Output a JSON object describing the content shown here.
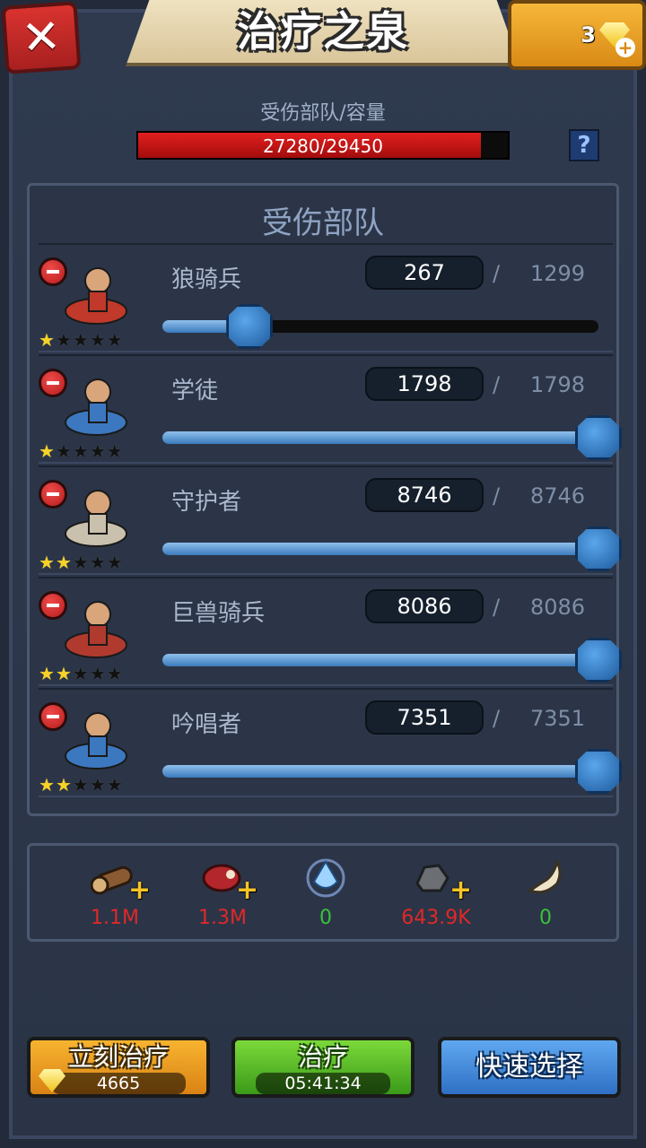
{
  "header": {
    "title": "治疗之泉",
    "gems": "3"
  },
  "capacity": {
    "label": "受伤部队/容量",
    "text": "27280/29450",
    "current": 27280,
    "max": 29450
  },
  "section": {
    "title": "受伤部队"
  },
  "troops": [
    {
      "name": "狼骑兵",
      "count": "267",
      "slash": "/",
      "max": "1299",
      "stars": 1,
      "fill": 0.2
    },
    {
      "name": "学徒",
      "count": "1798",
      "slash": "/",
      "max": "1798",
      "stars": 1,
      "fill": 1.0
    },
    {
      "name": "守护者",
      "count": "8746",
      "slash": "/",
      "max": "8746",
      "stars": 2,
      "fill": 1.0
    },
    {
      "name": "巨兽骑兵",
      "count": "8086",
      "slash": "/",
      "max": "8086",
      "stars": 2,
      "fill": 1.0
    },
    {
      "name": "吟唱者",
      "count": "7351",
      "slash": "/",
      "max": "7351",
      "stars": 2,
      "fill": 1.0
    }
  ],
  "resources": [
    {
      "icon": "wood-icon",
      "value": "1.1M",
      "color": "#e02828"
    },
    {
      "icon": "meat-icon",
      "value": "1.3M",
      "color": "#e02828"
    },
    {
      "icon": "crystal-icon",
      "value": "0",
      "color": "#39c23a"
    },
    {
      "icon": "stone-icon",
      "value": "643.9K",
      "color": "#e02828"
    },
    {
      "icon": "bone-icon",
      "value": "0",
      "color": "#39c23a"
    }
  ],
  "buttons": {
    "heal_now": {
      "label": "立刻治疗",
      "cost": "4665"
    },
    "heal": {
      "label": "治疗",
      "time": "05:41:34"
    },
    "quick_select": {
      "label": "快速选择"
    }
  },
  "colors": {
    "accent_gold": "#f7b430",
    "heal_green": "#5cbf2a",
    "quick_blue": "#4a8ddc"
  }
}
